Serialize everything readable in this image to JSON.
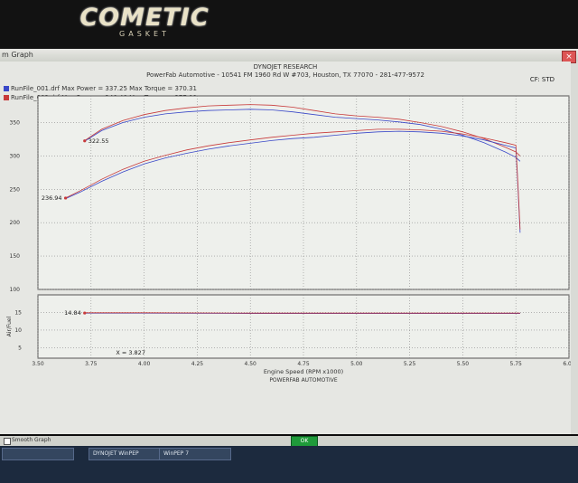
{
  "brand": {
    "logo_text": "COMETIC",
    "logo_sub": "GASKET"
  },
  "window": {
    "title": "m Graph",
    "close_label": "×",
    "cf_label": "CF: STD"
  },
  "header": {
    "line1": "DYNOJET RESEARCH",
    "line2": "PowerFab Automotive - 10541 FM 1960 Rd W #703, Houston, TX 77070 - 281-477-9572"
  },
  "legend": [
    {
      "label": "RunFile_001.drf Max Power = 337.25 Max Torque = 370.31",
      "color": "#3a48c8"
    },
    {
      "label": "RunFile_002.drf Max Power = 340.48 Max Torque = 377.09",
      "color": "#c83a3a"
    }
  ],
  "chart_data": {
    "type": "line",
    "xlabel": "Engine Speed (RPM x1000)",
    "x_ticks": [
      "3.50",
      "3.75",
      "4.00",
      "4.25",
      "4.50",
      "4.75",
      "5.00",
      "5.25",
      "5.50",
      "5.75",
      "6.00"
    ],
    "xlim": [
      3.5,
      6.0
    ],
    "upper_y_ticks": [
      "350",
      "300",
      "250",
      "200",
      "150",
      "100"
    ],
    "upper_ylim": [
      100,
      390
    ],
    "lower_ylabel": "Air/Fuel",
    "lower_y_ticks": [
      "15",
      "10",
      "5"
    ],
    "lower_ylim": [
      2,
      20
    ],
    "annotations": [
      {
        "text": "322.55",
        "x": 3.72,
        "y": 322.55
      },
      {
        "text": "236.94",
        "x": 3.63,
        "y": 236.94
      },
      {
        "text": "14.84",
        "x": 3.72,
        "y": 14.84
      },
      {
        "text": "X = 3.827",
        "x": 3.85,
        "y": 3.5
      }
    ],
    "footer": "POWERFAB AUTOMOTIVE",
    "series": [
      {
        "name": "RunFile_001.drf torque",
        "color": "#3a48c8",
        "x": [
          3.72,
          3.8,
          3.9,
          4.0,
          4.1,
          4.2,
          4.3,
          4.4,
          4.5,
          4.6,
          4.7,
          4.8,
          4.9,
          5.0,
          5.1,
          5.2,
          5.3,
          5.4,
          5.5,
          5.6,
          5.7,
          5.75,
          5.77
        ],
        "y": [
          322,
          338,
          350,
          358,
          363,
          366,
          368,
          369,
          370,
          369,
          366,
          362,
          358,
          356,
          354,
          351,
          347,
          340,
          331,
          320,
          306,
          298,
          292
        ]
      },
      {
        "name": "RunFile_002.drf torque",
        "color": "#c83a3a",
        "x": [
          3.72,
          3.8,
          3.9,
          4.0,
          4.1,
          4.2,
          4.3,
          4.4,
          4.5,
          4.6,
          4.7,
          4.8,
          4.9,
          5.0,
          5.1,
          5.2,
          5.3,
          5.4,
          5.5,
          5.6,
          5.7,
          5.75,
          5.77
        ],
        "y": [
          323,
          340,
          353,
          362,
          368,
          372,
          375,
          376,
          377,
          376,
          373,
          368,
          363,
          360,
          358,
          355,
          350,
          344,
          336,
          326,
          313,
          306,
          300
        ]
      },
      {
        "name": "RunFile_001.drf power",
        "color": "#3a48c8",
        "x": [
          3.63,
          3.7,
          3.8,
          3.9,
          4.0,
          4.1,
          4.2,
          4.3,
          4.4,
          4.5,
          4.6,
          4.7,
          4.8,
          4.9,
          5.0,
          5.1,
          5.2,
          5.3,
          5.4,
          5.5,
          5.6,
          5.7,
          5.75,
          5.76,
          5.77
        ],
        "y": [
          236,
          246,
          262,
          276,
          288,
          297,
          304,
          310,
          315,
          319,
          323,
          326,
          328,
          331,
          334,
          336,
          337,
          336,
          334,
          330,
          324,
          316,
          312,
          250,
          185
        ]
      },
      {
        "name": "RunFile_002.drf power",
        "color": "#c83a3a",
        "x": [
          3.63,
          3.7,
          3.8,
          3.9,
          4.0,
          4.1,
          4.2,
          4.3,
          4.4,
          4.5,
          4.6,
          4.7,
          4.8,
          4.9,
          5.0,
          5.1,
          5.2,
          5.3,
          5.4,
          5.5,
          5.6,
          5.7,
          5.75,
          5.76,
          5.77
        ],
        "y": [
          237,
          248,
          265,
          280,
          292,
          301,
          309,
          315,
          320,
          324,
          328,
          331,
          334,
          336,
          338,
          340,
          340,
          339,
          337,
          333,
          327,
          320,
          316,
          255,
          190
        ]
      },
      {
        "name": "RunFile_001.drf air/fuel",
        "color": "#3a48c8",
        "x": [
          3.72,
          4.0,
          4.5,
          5.0,
          5.5,
          5.77
        ],
        "y": [
          14.8,
          14.8,
          14.7,
          14.7,
          14.7,
          14.7
        ]
      },
      {
        "name": "RunFile_002.drf air/fuel",
        "color": "#c83a3a",
        "x": [
          3.72,
          4.0,
          4.5,
          5.0,
          5.5,
          5.77
        ],
        "y": [
          14.9,
          14.9,
          14.8,
          14.8,
          14.8,
          14.8
        ]
      }
    ]
  },
  "statusbar": {
    "checkbox_label": "Smooth Graph",
    "ok_label": "OK"
  },
  "taskbar": {
    "items": [
      "",
      "DYNOJET WinPEP",
      "WinPEP 7"
    ]
  }
}
